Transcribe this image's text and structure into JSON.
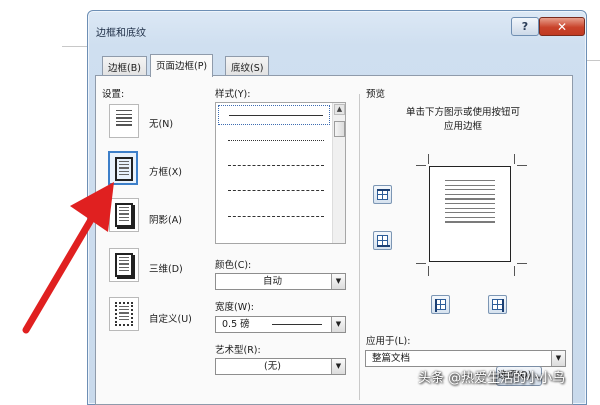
{
  "dialog": {
    "title": "边框和底纹",
    "help_label": "?",
    "close_label": "✕"
  },
  "tabs": [
    {
      "label": "边框(B)"
    },
    {
      "label": "页面边框(P)"
    },
    {
      "label": "底纹(S)"
    }
  ],
  "settings": {
    "heading": "设置:",
    "items": [
      {
        "label": "无(N)",
        "icon": "no-border-page-icon"
      },
      {
        "label": "方框(X)",
        "icon": "box-border-page-icon"
      },
      {
        "label": "阴影(A)",
        "icon": "shadow-border-page-icon"
      },
      {
        "label": "三维(D)",
        "icon": "3d-border-page-icon"
      },
      {
        "label": "自定义(U)",
        "icon": "custom-border-page-icon"
      }
    ],
    "selected": "方框(X)"
  },
  "style": {
    "heading": "样式(Y):"
  },
  "color": {
    "heading": "颜色(C):",
    "value": "自动"
  },
  "width": {
    "heading": "宽度(W):",
    "value": "0.5 磅"
  },
  "art": {
    "heading": "艺术型(R):",
    "value": "(无)"
  },
  "preview": {
    "heading": "预览",
    "hint_line1": "单击下方图示或使用按钮可",
    "hint_line2": "应用边框"
  },
  "apply_to": {
    "heading": "应用于(L):",
    "value": "整篇文档"
  },
  "ok_button": {
    "label": "选项(O)..."
  },
  "watermark": {
    "text": "头条 @热爱生活的小小鸟"
  },
  "colors": {
    "accent": "#3d7fc9",
    "annotation_arrow": "#e02020"
  }
}
